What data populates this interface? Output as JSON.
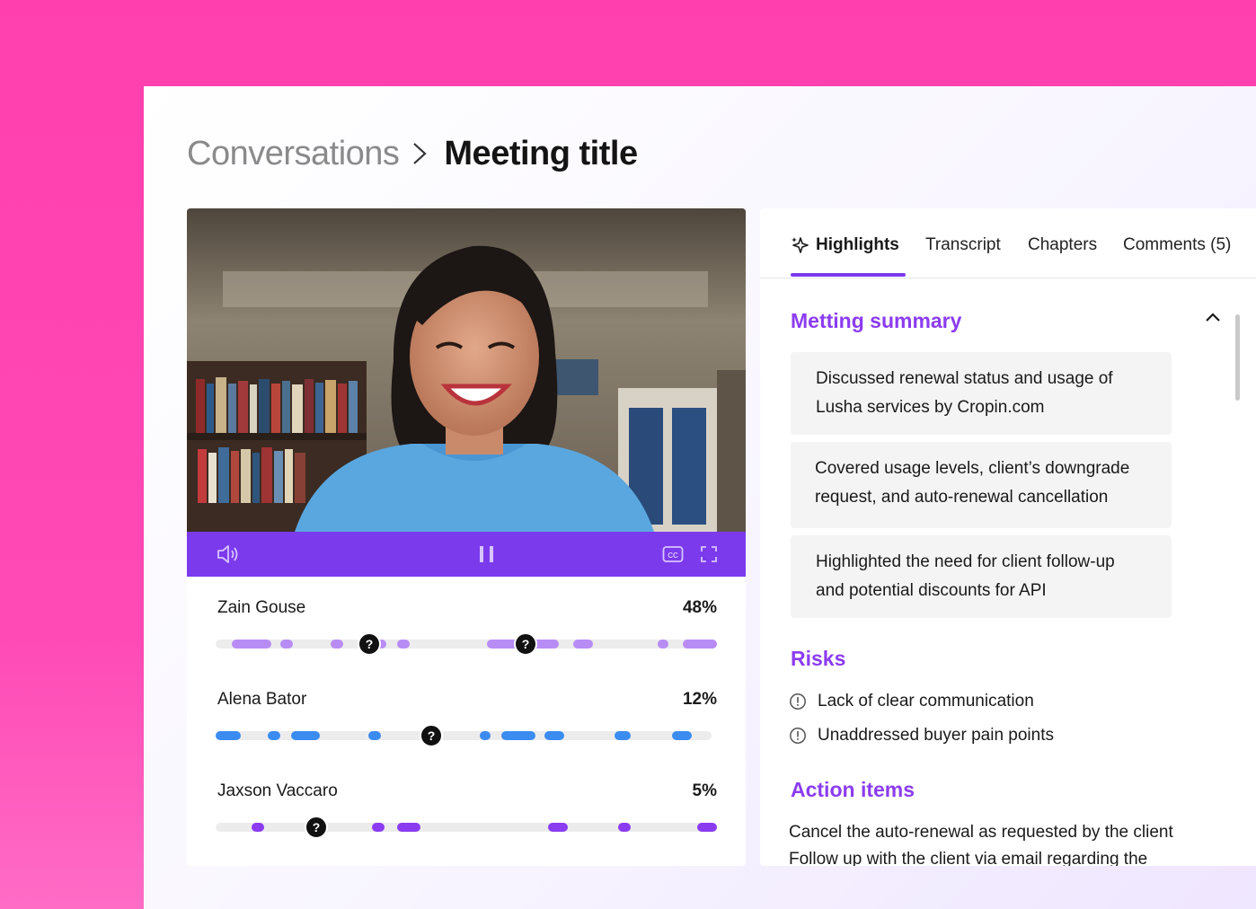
{
  "breadcrumb": {
    "parent": "Conversations",
    "current": "Meeting title"
  },
  "player": {
    "state": "playing",
    "controls": [
      "volume-icon",
      "pause-icon",
      "captions-icon",
      "fullscreen-icon"
    ]
  },
  "speakers": [
    {
      "name": "Zain Gouse",
      "percent": "48%",
      "color": "#b88cf5"
    },
    {
      "name": "Alena Bator",
      "percent": "12%",
      "color": "#3b8cf0"
    },
    {
      "name": "Jaxson Vaccaro",
      "percent": "5%",
      "color": "#8b3cf0"
    }
  ],
  "tabs": [
    {
      "label": "Highlights",
      "active": true
    },
    {
      "label": "Transcript",
      "active": false
    },
    {
      "label": "Chapters",
      "active": false
    },
    {
      "label": "Comments (5)",
      "active": false
    }
  ],
  "summary": {
    "title": "Metting summary",
    "items": [
      {
        "line1": "Discussed renewal status and usage of",
        "line2": "Lusha services by Cropin.com"
      },
      {
        "line1": "Covered  usage levels, client’s downgrade",
        "line2": "request, and auto-renewal cancellation"
      },
      {
        "line1": "Highlighted the need for client follow-up",
        "line2": "and potential discounts for API"
      }
    ]
  },
  "risks": {
    "title": "Risks",
    "items": [
      "Lack of clear communication",
      "Unaddressed buyer pain points"
    ]
  },
  "actions": {
    "title": "Action items",
    "items": [
      "Cancel the auto-renewal as requested by the client",
      "Follow up with the client via email regarding the"
    ]
  },
  "colors": {
    "background": "#ff3fae",
    "accent": "#7c3aed",
    "section_title": "#8b3cf0"
  }
}
